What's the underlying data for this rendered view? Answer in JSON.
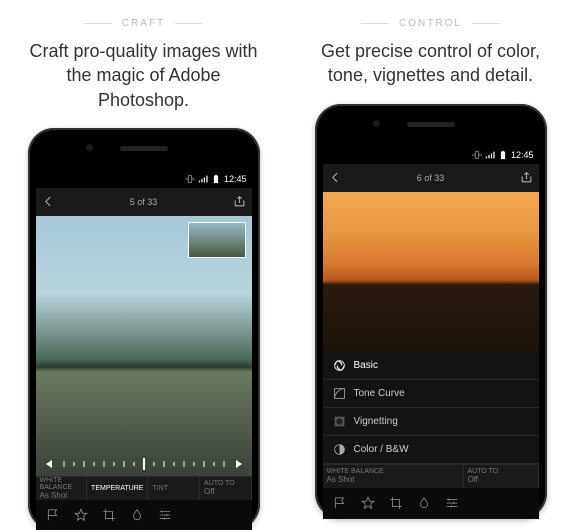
{
  "left": {
    "tag": "CRAFT",
    "blurb_strong": "Craft pro-quality images",
    "blurb_rest": " with the magic of Adobe Photoshop.",
    "status_time": "12:45",
    "counter": "5 of 33",
    "controls": {
      "wb_label": "WHITE BALANCE",
      "wb_value": "As Shot",
      "temp_label": "TEMPERATURE",
      "tint_label": "TINT",
      "auto_label": "AUTO TO",
      "auto_value": "Off"
    }
  },
  "right": {
    "tag": "CONTROL",
    "blurb_strong": "Get precise control",
    "blurb_rest": " of color, tone, vignettes and detail.",
    "status_time": "12:45",
    "counter": "6 of 33",
    "panel": {
      "basic": "Basic",
      "tone": "Tone Curve",
      "vignette": "Vignetting",
      "colorbw": "Color / B&W"
    },
    "controls": {
      "wb_label": "WHITE BALANCE",
      "wb_value": "As Shot",
      "auto_label": "AUTO TO",
      "auto_value": "Off"
    }
  }
}
